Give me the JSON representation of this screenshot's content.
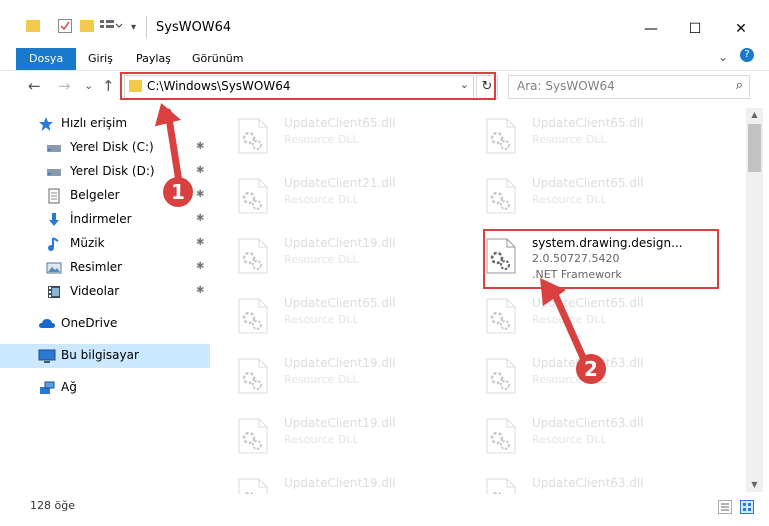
{
  "window": {
    "title": "SysWOW64",
    "minimize": "—",
    "maximize": "☐",
    "close": "✕"
  },
  "ribbon": {
    "tabs": [
      "Dosya",
      "Giriş",
      "Paylaş",
      "Görünüm"
    ],
    "expand": "⌄",
    "help": "?"
  },
  "nav": {
    "back": "←",
    "forward": "→",
    "recent": "⌄",
    "up": "↑",
    "address": "C:\\Windows\\SysWOW64",
    "address_dropdown": "⌄",
    "refresh": "↻",
    "search_placeholder": "Ara: SysWOW64",
    "search_icon": "⌕"
  },
  "sidebar": {
    "quick_access": "Hızlı erişim",
    "items": [
      {
        "label": "Yerel Disk (C:)",
        "icon": "drive-icon"
      },
      {
        "label": "Yerel Disk (D:)",
        "icon": "drive-icon"
      },
      {
        "label": "Belgeler",
        "icon": "documents-icon"
      },
      {
        "label": "İndirmeler",
        "icon": "downloads-icon"
      },
      {
        "label": "Müzik",
        "icon": "music-icon"
      },
      {
        "label": "Resimler",
        "icon": "pictures-icon"
      },
      {
        "label": "Videolar",
        "icon": "videos-icon"
      }
    ],
    "pin_glyph": "📌",
    "onedrive": "OneDrive",
    "this_pc": "Bu bilgisayar",
    "network": "Ağ"
  },
  "files": [
    {
      "name": "UpdateClient65.dll",
      "desc": "Resource DLL"
    },
    {
      "name": "UpdateClient65.dll",
      "desc": "Resource DLL"
    },
    {
      "name": "UpdateClient21.dll",
      "desc": "Resource DLL"
    },
    {
      "name": "UpdateClient65.dll",
      "desc": "Resource DLL"
    },
    {
      "name": "UpdateClient19.dll",
      "desc": "Resource DLL"
    },
    {
      "name": "system.drawing.design...",
      "desc": "2.0.50727.5420",
      "desc2": ".NET Framework",
      "selected": true
    },
    {
      "name": "UpdateClient65.dll",
      "desc": "Resource DLL"
    },
    {
      "name": "UpdateClient65.dll",
      "desc": "Resource DLL"
    },
    {
      "name": "UpdateClient19.dll",
      "desc": "Resource DLL"
    },
    {
      "name": "UpdateClient63.dll",
      "desc": "Resource DLL"
    },
    {
      "name": "UpdateClient19.dll",
      "desc": "Resource DLL"
    },
    {
      "name": "UpdateClient63.dll",
      "desc": "Resource DLL"
    },
    {
      "name": "UpdateClient19.dll",
      "desc": ""
    },
    {
      "name": "UpdateClient63.dll",
      "desc": ""
    }
  ],
  "status": {
    "count": "128 öğe"
  },
  "annotations": {
    "badge1": "1",
    "badge2": "2"
  },
  "colors": {
    "accent": "#1979ca",
    "highlight": "#d94141",
    "selected_nav": "#cce8ff"
  }
}
